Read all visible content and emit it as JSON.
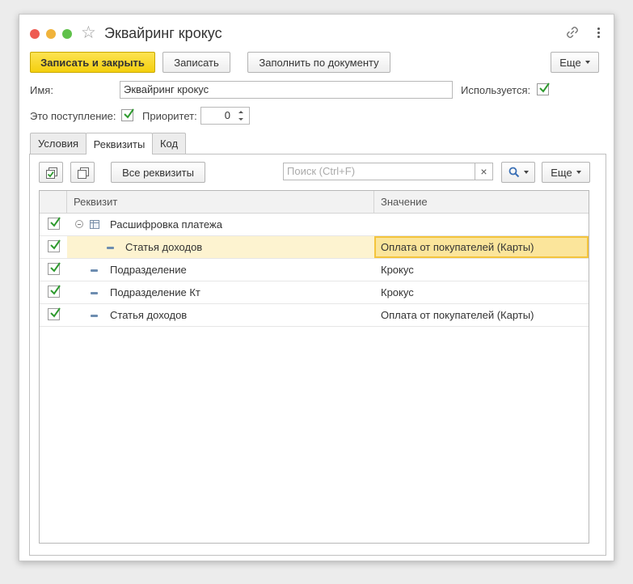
{
  "window": {
    "title": "Эквайринг крокус"
  },
  "toolbar": {
    "save_close": "Записать и закрыть",
    "save": "Записать",
    "fill_by_doc": "Заполнить по документу",
    "more": "Еще"
  },
  "form": {
    "name_label": "Имя:",
    "name_value": "Эквайринг крокус",
    "used_label": "Используется:",
    "used_checked": true,
    "income_label": "Это поступление:",
    "income_checked": true,
    "priority_label": "Приоритет:",
    "priority_value": "0"
  },
  "tabs": [
    {
      "label": "Условия",
      "active": false
    },
    {
      "label": "Реквизиты",
      "active": true
    },
    {
      "label": "Код",
      "active": false
    }
  ],
  "panel": {
    "all_attrs": "Все реквизиты",
    "search_placeholder": "Поиск (Ctrl+F)",
    "clear": "×",
    "more": "Еще"
  },
  "grid": {
    "columns": [
      "Реквизит",
      "Значение"
    ],
    "rows": [
      {
        "checked": true,
        "level": 0,
        "kind": "group",
        "name": "Расшифровка платежа",
        "value": ""
      },
      {
        "checked": true,
        "level": 1,
        "kind": "item",
        "name": "Статья доходов",
        "value": "Оплата от покупателей (Карты)",
        "selected": true
      },
      {
        "checked": true,
        "level": 0,
        "kind": "item",
        "name": "Подразделение",
        "value": "Крокус"
      },
      {
        "checked": true,
        "level": 0,
        "kind": "item",
        "name": "Подразделение Кт",
        "value": "Крокус"
      },
      {
        "checked": true,
        "level": 0,
        "kind": "item",
        "name": "Статья доходов",
        "value": "Оплата от покупателей (Карты)"
      }
    ]
  },
  "colors": {
    "primary_button": "#f4cf0e",
    "check_mark": "#2e9a2e",
    "selected_cell": "#fbe59b"
  }
}
